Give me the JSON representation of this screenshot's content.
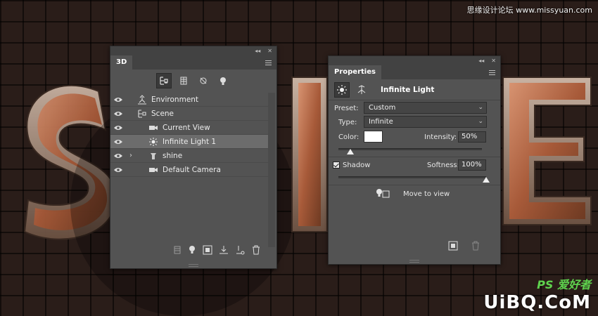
{
  "watermarks": {
    "top": "思缘设计论坛 www.missyuan.com",
    "bottom_small": "PS 爱好者",
    "bottom_big": "UiBQ.CoM"
  },
  "panel_3d": {
    "tab": "3D",
    "filters": [
      {
        "icon": "scene-filter-icon",
        "active": true
      },
      {
        "icon": "mesh-filter-icon",
        "active": false
      },
      {
        "icon": "material-filter-icon",
        "active": false
      },
      {
        "icon": "light-filter-icon",
        "active": false
      }
    ],
    "layers": [
      {
        "label": "Environment",
        "icon": "environment-icon",
        "indent": 0,
        "expander": false,
        "selected": false
      },
      {
        "label": "Scene",
        "icon": "scene-icon",
        "indent": 0,
        "expander": false,
        "selected": false
      },
      {
        "label": "Current View",
        "icon": "camera-icon",
        "indent": 1,
        "expander": false,
        "selected": false
      },
      {
        "label": "Infinite Light 1",
        "icon": "infinite-light-icon",
        "indent": 1,
        "expander": false,
        "selected": true
      },
      {
        "label": "shine",
        "icon": "mesh-icon",
        "indent": 1,
        "expander": true,
        "selected": false
      },
      {
        "label": "Default Camera",
        "icon": "camera-icon",
        "indent": 1,
        "expander": false,
        "selected": false
      }
    ],
    "bottom_icons": [
      "mesh-new-icon",
      "light-new-icon",
      "render-icon",
      "ground-drop-icon",
      "add-object-icon",
      "trash-icon"
    ]
  },
  "panel_props": {
    "tab": "Properties",
    "title": "Infinite Light",
    "preset_label": "Preset:",
    "preset_value": "Custom",
    "type_label": "Type:",
    "type_value": "Infinite",
    "color_label": "Color:",
    "color_value": "#ffffff",
    "intensity_label": "Intensity:",
    "intensity_value": "50%",
    "intensity_fraction": 0.5,
    "shadow_label": "Shadow",
    "shadow_checked": true,
    "softness_label": "Softness:",
    "softness_value": "100%",
    "softness_fraction": 1.0,
    "move_to_view": "Move to view"
  },
  "colors": {
    "panel_bg": "#535353",
    "panel_header": "#424242",
    "selected_row": "#6c6c6c",
    "text_3d_copper": "#b8724f"
  }
}
